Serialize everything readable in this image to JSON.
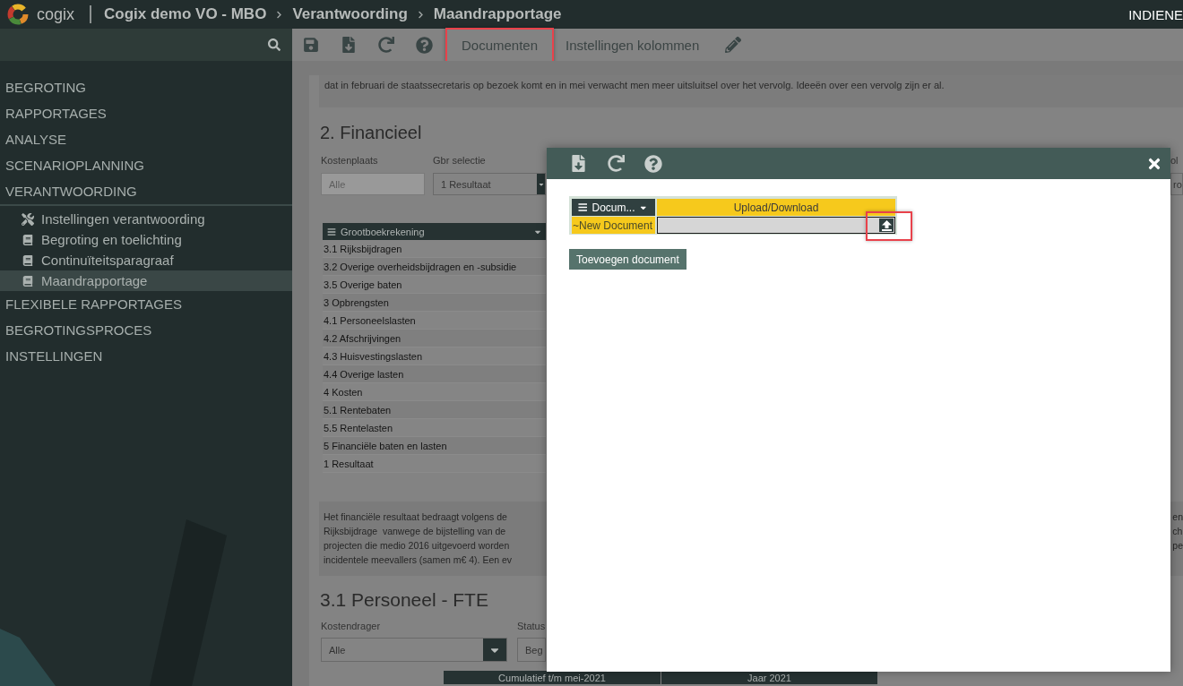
{
  "header": {
    "brand": "cogix",
    "breadcrumb": [
      "Cogix demo VO - MBO",
      "Verantwoording",
      "Maandrapportage"
    ],
    "action": "INDIENE"
  },
  "sidebar": {
    "items": [
      {
        "label": "BEGROTING",
        "expanded": false
      },
      {
        "label": "RAPPORTAGES",
        "expanded": false
      },
      {
        "label": "ANALYSE",
        "expanded": false
      },
      {
        "label": "SCENARIOPLANNING",
        "expanded": false
      },
      {
        "label": "VERANTWOORDING",
        "expanded": true,
        "children": [
          {
            "label": "Instellingen verantwoording",
            "kind": "tools",
            "selected": false
          },
          {
            "label": "Begroting en toelichting",
            "kind": "page",
            "selected": false
          },
          {
            "label": "Continuïteitsparagraaf",
            "kind": "page",
            "selected": false
          },
          {
            "label": "Maandrapportage",
            "kind": "page",
            "selected": true
          }
        ]
      },
      {
        "label": "FLEXIBELE RAPPORTAGES",
        "expanded": false
      },
      {
        "label": "BEGROTINGSPROCES",
        "expanded": false
      },
      {
        "label": "INSTELLINGEN",
        "expanded": false
      }
    ]
  },
  "toolbar": {
    "buttons": [
      {
        "label": "Documenten",
        "highlighted": true
      },
      {
        "label": "Instellingen kolommen",
        "highlighted": false
      }
    ]
  },
  "content": {
    "intro": "dat in februari de staatssecretaris op bezoek komt en in mei verwacht men meer uitsluitsel over het vervolg. Ideeën over een vervolg zijn er al.",
    "financieel": {
      "title": "2. Financieel",
      "filters": [
        {
          "label": "Kostenplaats",
          "value": "Alle",
          "kind": "input",
          "disabled": true
        },
        {
          "label": "Gbr selectie",
          "value": "1 Resultaat",
          "kind": "select",
          "disabled": false
        }
      ],
      "edge_filter": {
        "label": "ol",
        "value": "ro"
      },
      "table": {
        "column": "Grootboekrekening",
        "rows": [
          "3.1 Rijksbijdragen",
          "3.2 Overige overheidsbijdragen en -subsidie",
          "3.5 Overige baten",
          "3 Opbrengsten",
          "4.1 Personeelslasten",
          "4.2 Afschrijvingen",
          "4.3 Huisvestingslasten",
          "4.4 Overige lasten",
          "4 Kosten",
          "5.1 Rentebaten",
          "5.5 Rentelasten",
          "5 Financiële baten en lasten",
          "1 Resultaat"
        ]
      },
      "note": {
        "lines": [
          "Het financiële resultaat bedraagt volgens de",
          "Rijksbijdrage  vanwege de bijstelling van de",
          "projecten die medio 2016 uitgevoerd worden",
          "incidentele meevallers (samen m€ 4). Een ev"
        ],
        "line_ends": [
          "en",
          "ch",
          "pe"
        ]
      }
    },
    "personeel": {
      "title": "3.1 Personeel - FTE",
      "filters": [
        {
          "label": "Kostendrager",
          "value": "Alle",
          "kind": "select",
          "disabled": false
        },
        {
          "label": "Status",
          "value": "Beg",
          "kind": "input",
          "disabled": false
        }
      ],
      "columns": [
        "Cumulatief t/m mei-2021",
        "Jaar 2021"
      ]
    }
  },
  "modal": {
    "documents": {
      "columns": [
        "Docum...",
        "Upload/Download"
      ],
      "rows": [
        {
          "name": "~New Document",
          "upload_highlighted": true
        }
      ]
    },
    "add_button": "Toevoegen document"
  }
}
